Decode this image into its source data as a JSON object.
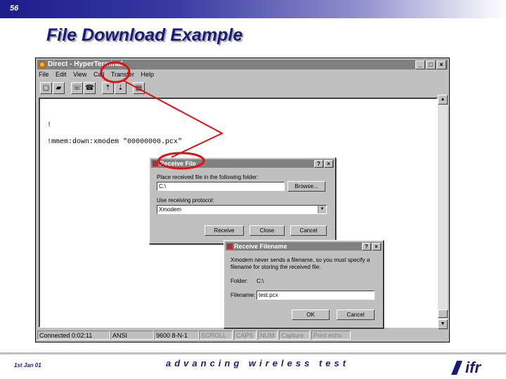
{
  "slide": {
    "number": "56",
    "title": "File Download Example",
    "footer_date": "1st Jan 01",
    "tagline": "advancing wireless test",
    "logo_text": "ifr"
  },
  "window": {
    "title": "Direct - HyperTerminal",
    "minimize": "_",
    "maximize": "□",
    "close": "×",
    "menu": [
      "File",
      "Edit",
      "View",
      "Call",
      "Transfer",
      "Help"
    ],
    "toolbar_icons": [
      "new-icon",
      "open-icon",
      "phone-icon",
      "hangup-icon",
      "send-icon",
      "receive-icon",
      "properties-icon"
    ]
  },
  "terminal": {
    "lines": [
      "!",
      "!mmem:down:xmodem \"00000000.pcx\""
    ]
  },
  "status": {
    "connected": "Connected 0:02:11",
    "emulation": "ANSI",
    "settings": "9600 8-N-1",
    "scroll": "SCROLL",
    "caps": "CAPS",
    "num": "NUM",
    "capture": "Capture",
    "print": "Print echo"
  },
  "receive_file": {
    "title": "Receive File",
    "help": "?",
    "close_x": "×",
    "folder_label": "Place received file in the following folder:",
    "folder_value": "C:\\",
    "browse": "Browse...",
    "protocol_label": "Use receiving protocol:",
    "protocol_value": "Xmodem",
    "receive": "Receive",
    "close": "Close",
    "cancel": "Cancel"
  },
  "receive_filename": {
    "title": "Receive Filename",
    "help": "?",
    "close_x": "×",
    "message_1": "Xmodem never sends a filename, so you must specify a",
    "message_2": "filename for storing the received file.",
    "folder_label": "Folder:",
    "folder_value": "C:\\",
    "filename_label": "Filename:",
    "filename_value": "test.pcx",
    "ok": "OK",
    "cancel": "Cancel"
  },
  "colors": {
    "annotation": "#e01010",
    "brand": "#1a1a7a"
  }
}
